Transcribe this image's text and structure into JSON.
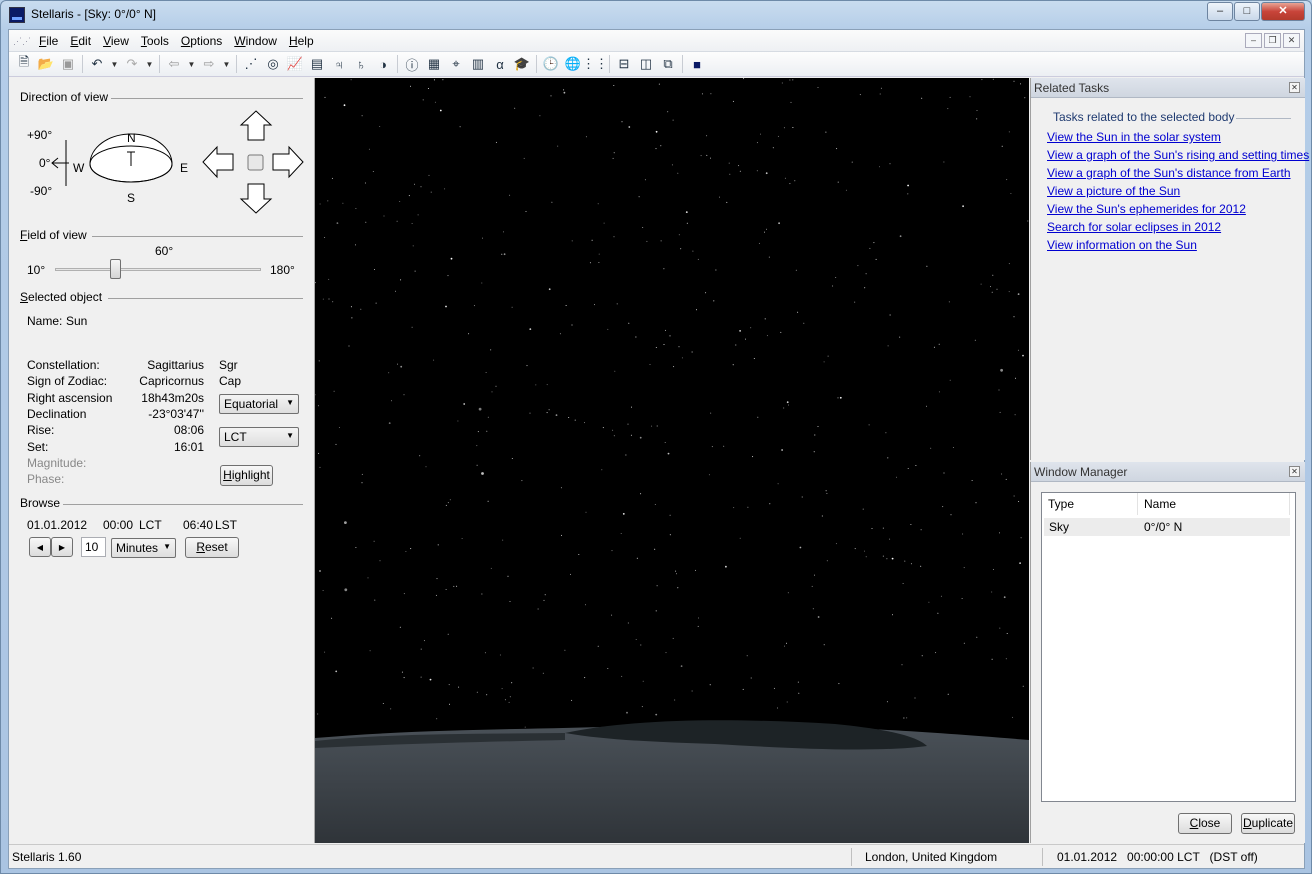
{
  "window": {
    "title": "Stellaris - [Sky: 0°/0° N]",
    "buttons": {
      "minimize": "–",
      "maximize": "□",
      "close": "✕"
    }
  },
  "menu": [
    "File",
    "Edit",
    "View",
    "Tools",
    "Options",
    "Window",
    "Help"
  ],
  "menu_mnemonics": [
    "F",
    "E",
    "V",
    "T",
    "O",
    "W",
    "H"
  ],
  "direction_of_view": {
    "heading": "Direction of view",
    "alt_labels": [
      "+90°",
      "0°",
      "-90°"
    ],
    "compass": {
      "n": "N",
      "s": "S",
      "e": "E",
      "w": "W"
    }
  },
  "field_of_view": {
    "heading": "Field of view",
    "value": "60°",
    "min": "10°",
    "max": "180°",
    "fraction": 0.29
  },
  "selected_object": {
    "heading": "Selected object",
    "name_label": "Name:",
    "name_value": "Sun",
    "rows": [
      {
        "label": "Constellation:",
        "value": "Sagittarius",
        "abbr": "Sgr"
      },
      {
        "label": "Sign of Zodiac:",
        "value": "Capricornus",
        "abbr": "Cap"
      },
      {
        "label": "Right ascension",
        "value": "18h43m20s",
        "abbr": ""
      },
      {
        "label": "Declination",
        "value": "-23°03'47''",
        "abbr": ""
      },
      {
        "label": "Rise:",
        "value": "08:06",
        "abbr": ""
      },
      {
        "label": "Set:",
        "value": "16:01",
        "abbr": ""
      },
      {
        "label": "Magnitude:",
        "value": "",
        "abbr": ""
      },
      {
        "label": "Phase:",
        "value": "",
        "abbr": ""
      }
    ],
    "coord_system": "Equatorial",
    "time_system": "LCT",
    "highlight_label": "Highlight"
  },
  "browse": {
    "heading": "Browse",
    "date": "01.01.2012",
    "time": "00:00",
    "time_zone": "LCT",
    "sidereal": "06:40",
    "sidereal_label": "LST",
    "step": "10",
    "unit": "Minutes",
    "reset_label": "Reset"
  },
  "related_tasks": {
    "title": "Related Tasks",
    "heading": "Tasks related to the selected body",
    "links": [
      "View the Sun in the solar system",
      "View a graph of the Sun's rising and setting times",
      "View a graph of the Sun's distance from Earth",
      "View a picture of the Sun",
      "View the Sun's ephemerides for 2012",
      "Search for solar eclipses in 2012",
      "View information on the Sun"
    ]
  },
  "window_manager": {
    "title": "Window Manager",
    "columns": [
      "Type",
      "Name"
    ],
    "rows": [
      {
        "type": "Sky",
        "name": "0°/0° N"
      }
    ],
    "close_label": "Close",
    "duplicate_label": "Duplicate"
  },
  "status": {
    "app": "Stellaris 1.60",
    "location": "London, United Kingdom",
    "datetime": "01.01.2012   00:00:00 LCT   (DST off)"
  },
  "colors": {
    "link": "#0000d0",
    "sky": "#000000",
    "ground": "#3d4349"
  }
}
